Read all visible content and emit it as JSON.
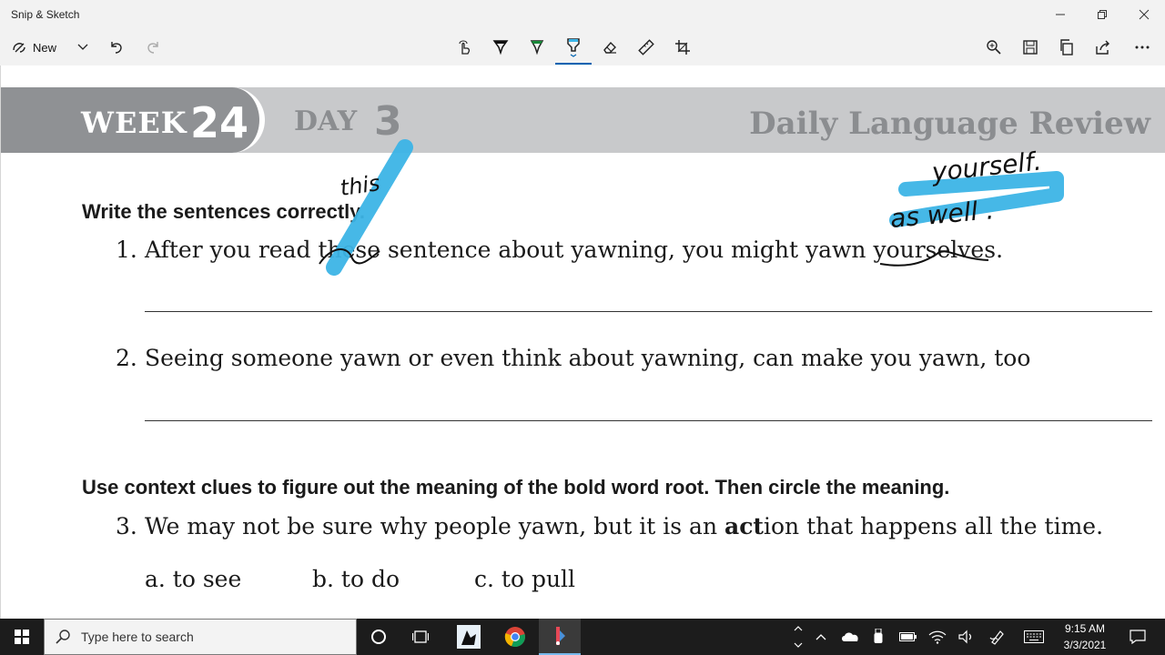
{
  "window": {
    "title": "Snip & Sketch",
    "controls": [
      "minimize",
      "restore",
      "close"
    ]
  },
  "toolbar": {
    "new_label": "New",
    "tools": [
      "touch-writing",
      "ballpoint-pen",
      "pencil",
      "highlighter",
      "eraser",
      "ruler",
      "crop"
    ],
    "selected_tool": "highlighter",
    "right_actions": [
      "zoom",
      "save",
      "copy",
      "share",
      "more"
    ]
  },
  "worksheet": {
    "week_word": "WEEK",
    "week_num": "24",
    "day_word": "DAY",
    "day_num": "3",
    "series": "Daily Language Review",
    "instruction1": "Write the sentences correctly.",
    "q1": {
      "num": "1.",
      "pre": "After you read ",
      "w1": "these",
      "mid": " sentence about yawning, you might yawn ",
      "w2": "yourselves",
      "end": "."
    },
    "q2": {
      "num": "2.",
      "text": "Seeing someone yawn or even think about yawning, can make you yawn, too"
    },
    "instruction2": "Use context clues to figure out the meaning of the bold word root. Then circle the meaning.",
    "q3": {
      "num": "3.",
      "pre": "We may not be sure why people yawn, but it is an ",
      "bold_root": "act",
      "post": "ion that happens all the time."
    },
    "choices": [
      "a. to see",
      "b. to do",
      "c. to pull"
    ]
  },
  "annotations": {
    "this": "this",
    "yourself": "yourself.",
    "as_well": "as well .",
    "highlight_color": "#3cb4e6"
  },
  "taskbar": {
    "search_placeholder": "Type here to search",
    "time": "9:15 AM",
    "date": "3/3/2021"
  }
}
